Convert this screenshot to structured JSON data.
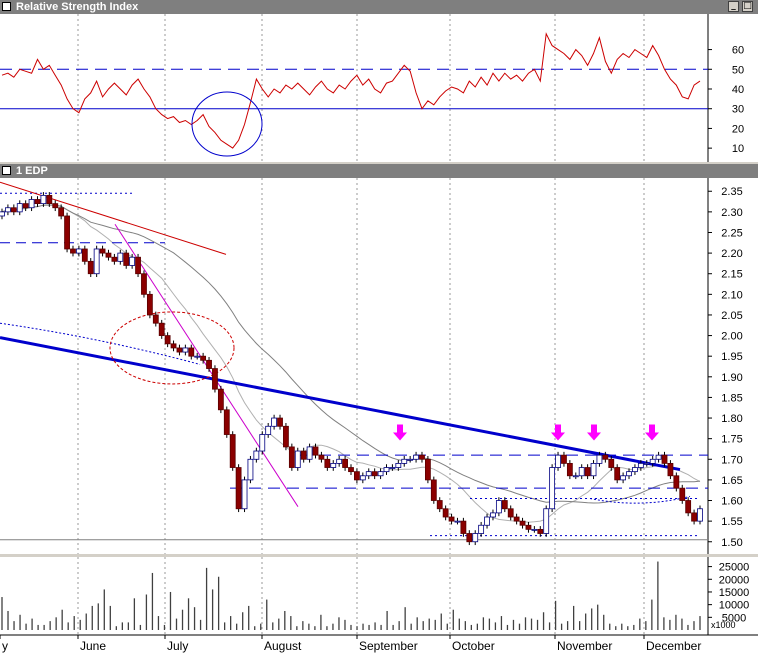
{
  "rsi_pane": {
    "title": "Relative Strength Index",
    "y_ticks": [
      "60",
      "50",
      "40",
      "30",
      "20",
      "10"
    ]
  },
  "price_pane": {
    "title": "1 EDP",
    "y_ticks": [
      "2.35",
      "2.30",
      "2.25",
      "2.20",
      "2.15",
      "2.10",
      "2.05",
      "2.00",
      "1.95",
      "1.90",
      "1.85",
      "1.80",
      "1.75",
      "1.70",
      "1.65",
      "1.60",
      "1.55",
      "1.50"
    ]
  },
  "volume_pane": {
    "y_ticks": [
      "25000",
      "20000",
      "15000",
      "10000",
      "5000"
    ],
    "unit_label": "x1000"
  },
  "x_axis": {
    "months": [
      "y",
      "June",
      "July",
      "August",
      "September",
      "October",
      "November",
      "December"
    ]
  },
  "window_buttons": {
    "minimize": "_",
    "maximize": "□"
  },
  "colors": {
    "up_candle": "#ffffff",
    "down_candle": "#8b0000",
    "rsi_line": "#cc0000",
    "trendline": "#0000cc",
    "arrow": "#ff00ff"
  },
  "chart_data": [
    {
      "type": "line",
      "title": "Relative Strength Index",
      "ylim": [
        5,
        75
      ],
      "reference_lines": [
        50,
        30
      ],
      "series": [
        {
          "name": "",
          "values": [
            47,
            48,
            46,
            50,
            49,
            48,
            55,
            50,
            52,
            47,
            42,
            35,
            30,
            28,
            35,
            38,
            44,
            36,
            40,
            43,
            40,
            37,
            42,
            45,
            40,
            36,
            30,
            27,
            25,
            26,
            23,
            24,
            22,
            24,
            27,
            21,
            18,
            14,
            12,
            10,
            14,
            22,
            33,
            45,
            40,
            36,
            40,
            38,
            42,
            40,
            43,
            40,
            37,
            41,
            44,
            40,
            38,
            42,
            40,
            44,
            47,
            42,
            45,
            40,
            38,
            43,
            44,
            48,
            52,
            49,
            38,
            30,
            34,
            32,
            36,
            39,
            41,
            40,
            38,
            44,
            41,
            46,
            42,
            48,
            44,
            48,
            45,
            47,
            44,
            48,
            50,
            44,
            68,
            62,
            60,
            58,
            55,
            60,
            57,
            52,
            58,
            66,
            54,
            48,
            55,
            58,
            56,
            60,
            58,
            56,
            62,
            57,
            50,
            45,
            42,
            36,
            35,
            42,
            44
          ]
        }
      ]
    },
    {
      "type": "candlestick",
      "title": "1 EDP",
      "ylim": [
        1.48,
        2.37
      ],
      "series": [
        {
          "name": "",
          "close": [
            2.3,
            2.31,
            2.3,
            2.32,
            2.31,
            2.33,
            2.32,
            2.34,
            2.32,
            2.31,
            2.29,
            2.21,
            2.2,
            2.21,
            2.18,
            2.15,
            2.21,
            2.2,
            2.19,
            2.18,
            2.2,
            2.17,
            2.19,
            2.15,
            2.1,
            2.05,
            2.03,
            2.0,
            1.98,
            1.97,
            1.96,
            1.97,
            1.95,
            1.95,
            1.94,
            1.92,
            1.87,
            1.82,
            1.76,
            1.68,
            1.58,
            1.65,
            1.7,
            1.72,
            1.76,
            1.78,
            1.8,
            1.78,
            1.73,
            1.68,
            1.72,
            1.7,
            1.73,
            1.71,
            1.7,
            1.68,
            1.69,
            1.7,
            1.68,
            1.67,
            1.65,
            1.66,
            1.67,
            1.66,
            1.67,
            1.68,
            1.68,
            1.69,
            1.7,
            1.7,
            1.71,
            1.7,
            1.65,
            1.6,
            1.58,
            1.56,
            1.55,
            1.55,
            1.52,
            1.5,
            1.52,
            1.54,
            1.56,
            1.57,
            1.6,
            1.58,
            1.56,
            1.55,
            1.54,
            1.53,
            1.53,
            1.52,
            1.58,
            1.68,
            1.71,
            1.69,
            1.66,
            1.66,
            1.68,
            1.66,
            1.69,
            1.71,
            1.7,
            1.68,
            1.65,
            1.66,
            1.67,
            1.68,
            1.69,
            1.69,
            1.7,
            1.71,
            1.69,
            1.66,
            1.63,
            1.6,
            1.57,
            1.55,
            1.58
          ]
        }
      ],
      "reference_lines": [
        1.71,
        1.63
      ],
      "annotations": [
        "arrow at 1.72 (September)",
        "arrow at 1.72 (November)",
        "arrow at 1.72 (November)",
        "arrow at 1.72 (December)"
      ]
    },
    {
      "type": "bar",
      "title": "",
      "ylim": [
        0,
        28000
      ],
      "series": [
        {
          "name": "",
          "values": [
            13000,
            7500,
            3500,
            6000,
            2500,
            4500,
            2000,
            2000,
            3500,
            5000,
            8000,
            3000,
            5500,
            4000,
            6500,
            9500,
            10500,
            16000,
            9500,
            1500,
            3000,
            3000,
            12500,
            2000,
            14000,
            22500,
            5500,
            2000,
            15000,
            4500,
            8000,
            12500,
            9000,
            4000,
            24500,
            16000,
            21000,
            3000,
            5500,
            2500,
            7000,
            9500,
            1500,
            2500,
            12000,
            3000,
            4500,
            7500,
            5500,
            1500,
            3500,
            2500,
            1500,
            6000,
            1500,
            2500,
            5000,
            4000,
            2000,
            1500,
            2500,
            2000,
            3000,
            2000,
            7500,
            2000,
            3500,
            9000,
            2500,
            5000,
            3500,
            4500,
            4000,
            6500,
            2500,
            8000,
            4500,
            3500,
            2000,
            2500,
            5000,
            4500,
            3000,
            5500,
            2000,
            4000,
            2500,
            5000,
            4500,
            4000,
            7000,
            3000,
            11500,
            2500,
            3500,
            9500,
            3500,
            6500,
            8500,
            10000,
            6000,
            2500,
            1500,
            2500,
            1500,
            2000,
            4500,
            3500,
            12000,
            27000,
            5000,
            4000,
            6000,
            4500,
            2000,
            3500,
            5500
          ]
        }
      ]
    }
  ]
}
